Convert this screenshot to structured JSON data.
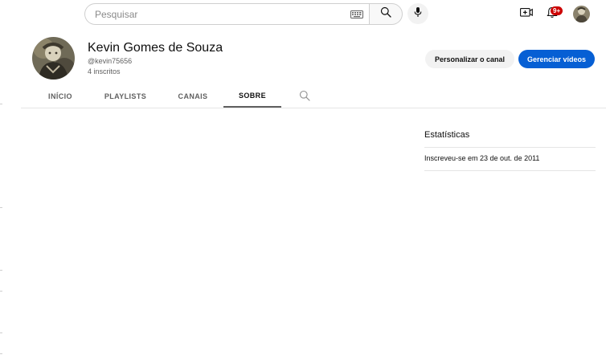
{
  "search": {
    "placeholder": "Pesquisar",
    "icons": {
      "keyboard": "keyboard-icon",
      "search": "search-icon",
      "mic": "microphone-icon"
    }
  },
  "topbar": {
    "icons": {
      "create": "video-add-icon",
      "notifications": "bell-icon"
    },
    "notification_badge": "9+",
    "badge_color": "#cc0000"
  },
  "channel": {
    "name": "Kevin Gomes de Souza",
    "handle": "@kevin75656",
    "subscribers": "4 inscritos"
  },
  "actions": {
    "customize_label": "Personalizar o canal",
    "manage_label": "Gerenciar vídeos",
    "accent_color": "#065fd4"
  },
  "tabs": [
    {
      "label": "INÍCIO"
    },
    {
      "label": "PLAYLISTS"
    },
    {
      "label": "CANAIS"
    },
    {
      "label": "SOBRE",
      "active": true
    }
  ],
  "about": {
    "stats_title": "Estatísticas",
    "joined": "Inscreveu-se em 23 de out. de 2011"
  }
}
